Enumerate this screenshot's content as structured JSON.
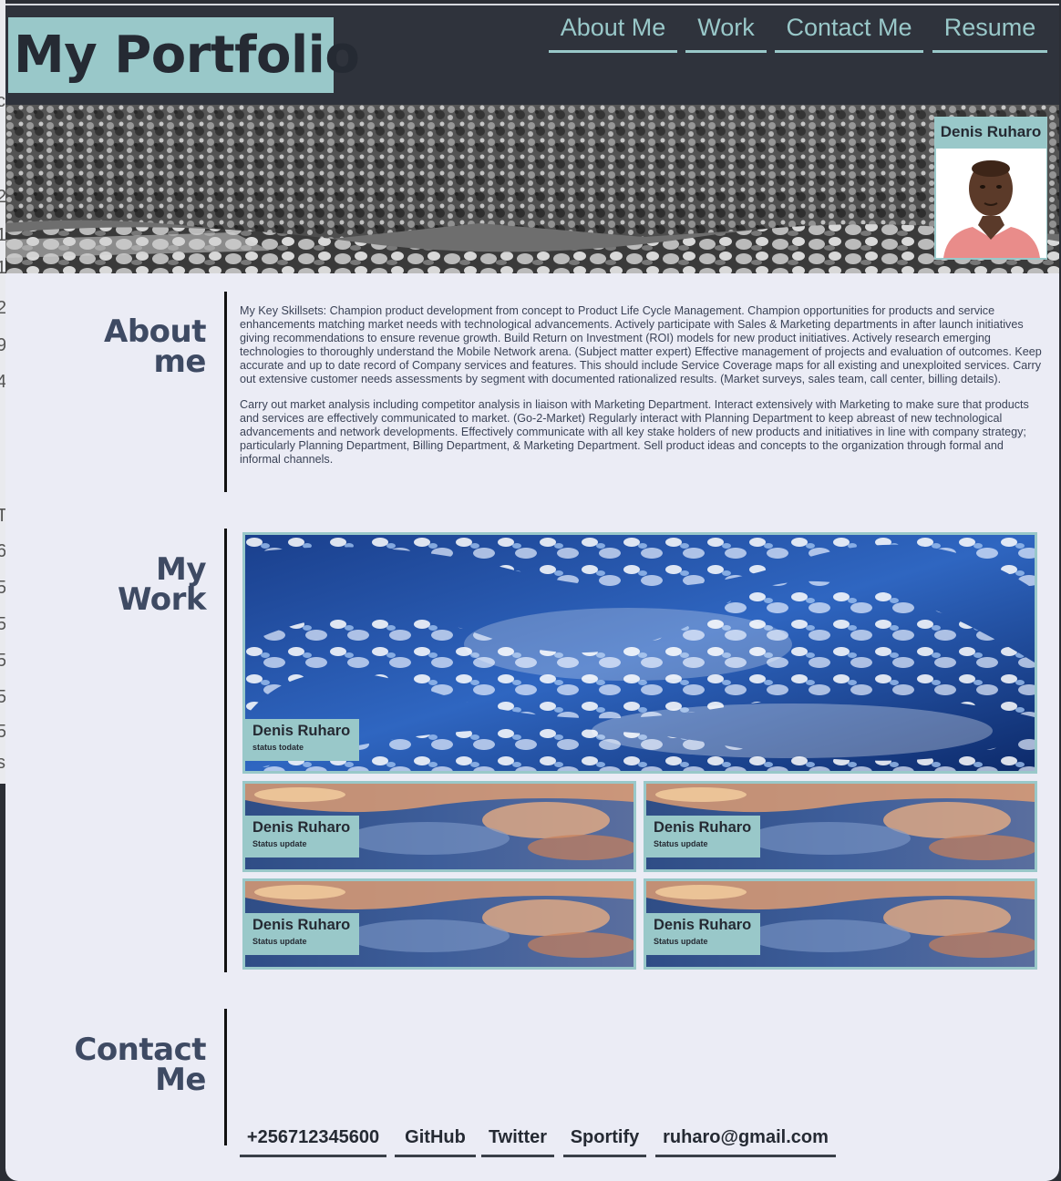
{
  "site": {
    "logo": "My Portfolio",
    "nav": [
      "About Me",
      "Work",
      "Contact Me",
      "Resume"
    ]
  },
  "hero": {
    "profile_name": "Denis Ruharo"
  },
  "about": {
    "heading_line1": "About",
    "heading_line2": "me",
    "paragraph1": "My Key Skillsets: Champion product development from concept to Product Life Cycle Management. Champion opportunities for products and service enhancements matching market needs with technological advancements. Actively participate with Sales & Marketing departments in after launch initiatives giving recommendations to ensure revenue growth. Build Return on Investment (ROI) models for new product initiatives. Actively research emerging technologies to thoroughly understand the Mobile Network arena. (Subject matter expert) Effective management of projects and evaluation of outcomes. Keep accurate and up to date record of Company services and features. This should include Service Coverage maps for all existing and unexploited services. Carry out extensive customer needs assessments by segment with documented rationalized results. (Market surveys, sales team, call center, billing details).",
    "paragraph2": "Carry out market analysis including competitor analysis in liaison with Marketing Department. Interact extensively with Marketing to make sure that products and services are effectively communicated to market. (Go-2-Market) Regularly interact with Planning Department to keep abreast of new technological advancements and network developments. Effectively communicate with all key stake holders of new products and initiatives in line with company strategy; particularly Planning Department, Billing Department, & Marketing Department. Sell product ideas and concepts to the organization through formal and informal channels."
  },
  "work": {
    "heading_line1": "My",
    "heading_line2": "Work",
    "featured": {
      "name": "Denis Ruharo",
      "status": "status todate"
    },
    "cards": [
      {
        "name": "Denis Ruharo",
        "status": "Status update"
      },
      {
        "name": "Denis Ruharo",
        "status": "Status update"
      },
      {
        "name": "Denis Ruharo",
        "status": "Status update"
      },
      {
        "name": "Denis Ruharo",
        "status": "Status update"
      }
    ]
  },
  "contact": {
    "heading_line1": "Contact",
    "heading_line2": "Me",
    "links": [
      "+256712345600",
      "GitHub",
      "Twitter",
      "Sportify",
      "ruharo@gmail.com"
    ]
  },
  "background_window": {
    "fragments": [
      "c",
      "2",
      "1",
      "1",
      "2",
      "9",
      "4",
      "T",
      "6",
      "5",
      "5",
      "5",
      "5",
      "5",
      "s"
    ]
  },
  "theme": {
    "accent": "#99c8c9",
    "header_bg": "#2f333c",
    "page_bg": "#ebecf5",
    "heading_text": "#3e4a63"
  }
}
